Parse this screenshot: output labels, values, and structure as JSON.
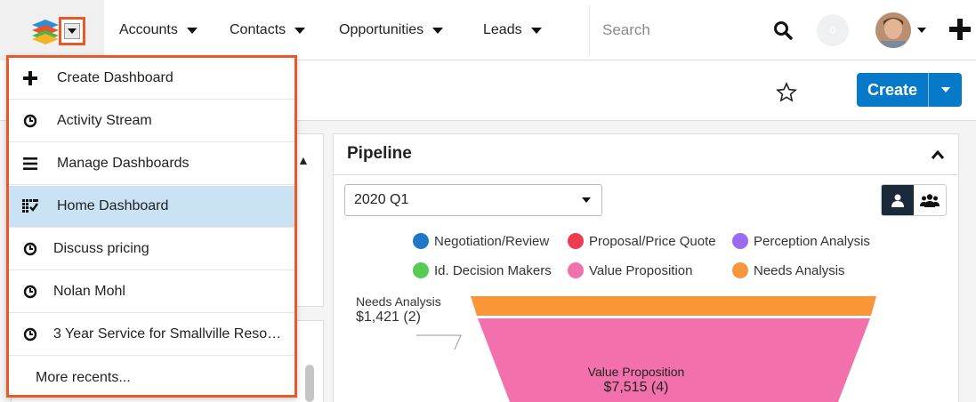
{
  "nav": {
    "items": [
      {
        "label": "Accounts"
      },
      {
        "label": "Contacts"
      },
      {
        "label": "Opportunities"
      },
      {
        "label": "Leads"
      }
    ],
    "search_placeholder": "Search",
    "notification_count": "0"
  },
  "header": {
    "create_label": "Create"
  },
  "menu": {
    "items": [
      {
        "label": "Create Dashboard",
        "icon": "plus-icon"
      },
      {
        "label": "Activity Stream",
        "icon": "clock-icon"
      },
      {
        "label": "Manage Dashboards",
        "icon": "hamburger-icon"
      },
      {
        "label": "Home Dashboard",
        "icon": "dashboard-icon",
        "active": true
      },
      {
        "label": "Discuss pricing",
        "icon": "clock-icon"
      },
      {
        "label": "Nolan Mohl",
        "icon": "clock-icon"
      },
      {
        "label": "3 Year Service for Smallville Resour...",
        "icon": "clock-icon"
      }
    ],
    "more_label": "More recents..."
  },
  "pipeline": {
    "title": "Pipeline",
    "period": "2020 Q1",
    "legend": [
      {
        "name": "Negotiation/Review",
        "color": "#1f77c8"
      },
      {
        "name": "Proposal/Price Quote",
        "color": "#ef3b4f"
      },
      {
        "name": "Perception Analysis",
        "color": "#9b6cf2"
      },
      {
        "name": "Id. Decision Makers",
        "color": "#55cc55"
      },
      {
        "name": "Value Proposition",
        "color": "#f271ac"
      },
      {
        "name": "Needs Analysis",
        "color": "#fb9638"
      }
    ],
    "stages": [
      {
        "name": "Needs Analysis",
        "value": "$1,421 (2)",
        "color": "#fb9638"
      },
      {
        "name": "Value Proposition",
        "value": "$7,515 (4)",
        "color": "#f271ac"
      }
    ]
  }
}
